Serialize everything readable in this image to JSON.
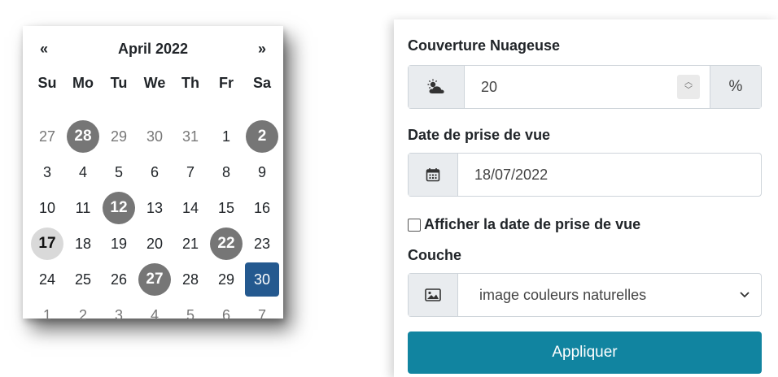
{
  "calendar": {
    "prev": "«",
    "next": "»",
    "title": "April 2022",
    "weekdays": [
      "Su",
      "Mo",
      "Tu",
      "We",
      "Th",
      "Fr",
      "Sa"
    ],
    "days": [
      {
        "label": "27",
        "muted": true,
        "style": ""
      },
      {
        "label": "28",
        "muted": true,
        "style": "circle"
      },
      {
        "label": "29",
        "muted": true,
        "style": ""
      },
      {
        "label": "30",
        "muted": true,
        "style": ""
      },
      {
        "label": "31",
        "muted": true,
        "style": ""
      },
      {
        "label": "1",
        "muted": false,
        "style": ""
      },
      {
        "label": "2",
        "muted": false,
        "style": "circle"
      },
      {
        "label": "3",
        "muted": false,
        "style": ""
      },
      {
        "label": "4",
        "muted": false,
        "style": ""
      },
      {
        "label": "5",
        "muted": false,
        "style": ""
      },
      {
        "label": "6",
        "muted": false,
        "style": ""
      },
      {
        "label": "7",
        "muted": false,
        "style": ""
      },
      {
        "label": "8",
        "muted": false,
        "style": ""
      },
      {
        "label": "9",
        "muted": false,
        "style": ""
      },
      {
        "label": "10",
        "muted": false,
        "style": ""
      },
      {
        "label": "11",
        "muted": false,
        "style": ""
      },
      {
        "label": "12",
        "muted": false,
        "style": "circle"
      },
      {
        "label": "13",
        "muted": false,
        "style": ""
      },
      {
        "label": "14",
        "muted": false,
        "style": ""
      },
      {
        "label": "15",
        "muted": false,
        "style": ""
      },
      {
        "label": "16",
        "muted": false,
        "style": ""
      },
      {
        "label": "17",
        "muted": false,
        "style": "today"
      },
      {
        "label": "18",
        "muted": false,
        "style": ""
      },
      {
        "label": "19",
        "muted": false,
        "style": ""
      },
      {
        "label": "20",
        "muted": false,
        "style": ""
      },
      {
        "label": "21",
        "muted": false,
        "style": ""
      },
      {
        "label": "22",
        "muted": false,
        "style": "circle"
      },
      {
        "label": "23",
        "muted": false,
        "style": ""
      },
      {
        "label": "24",
        "muted": false,
        "style": ""
      },
      {
        "label": "25",
        "muted": false,
        "style": ""
      },
      {
        "label": "26",
        "muted": false,
        "style": ""
      },
      {
        "label": "27",
        "muted": false,
        "style": "circle"
      },
      {
        "label": "28",
        "muted": false,
        "style": ""
      },
      {
        "label": "29",
        "muted": false,
        "style": ""
      },
      {
        "label": "30",
        "muted": false,
        "style": "active"
      },
      {
        "label": "1",
        "muted": true,
        "style": ""
      },
      {
        "label": "2",
        "muted": true,
        "style": ""
      },
      {
        "label": "3",
        "muted": true,
        "style": ""
      },
      {
        "label": "4",
        "muted": true,
        "style": ""
      },
      {
        "label": "5",
        "muted": true,
        "style": ""
      },
      {
        "label": "6",
        "muted": true,
        "style": ""
      },
      {
        "label": "7",
        "muted": true,
        "style": ""
      }
    ],
    "colors": {
      "circle": "#767676",
      "today": "#d9d9d9",
      "active": "#24598f"
    }
  },
  "form": {
    "cloud_label": "Couverture Nuageuse",
    "cloud_icon": "cloud-sun-icon",
    "cloud_value": "20",
    "cloud_unit": "%",
    "date_label": "Date de prise de vue",
    "date_icon": "calendar-icon",
    "date_value": "18/07/2022",
    "show_date_label": "Afficher la date de prise de vue",
    "show_date_checked": false,
    "layer_label": "Couche",
    "layer_icon": "image-icon",
    "layer_value": "image couleurs naturelles",
    "apply_label": "Appliquer",
    "apply_color": "#1184a0"
  }
}
